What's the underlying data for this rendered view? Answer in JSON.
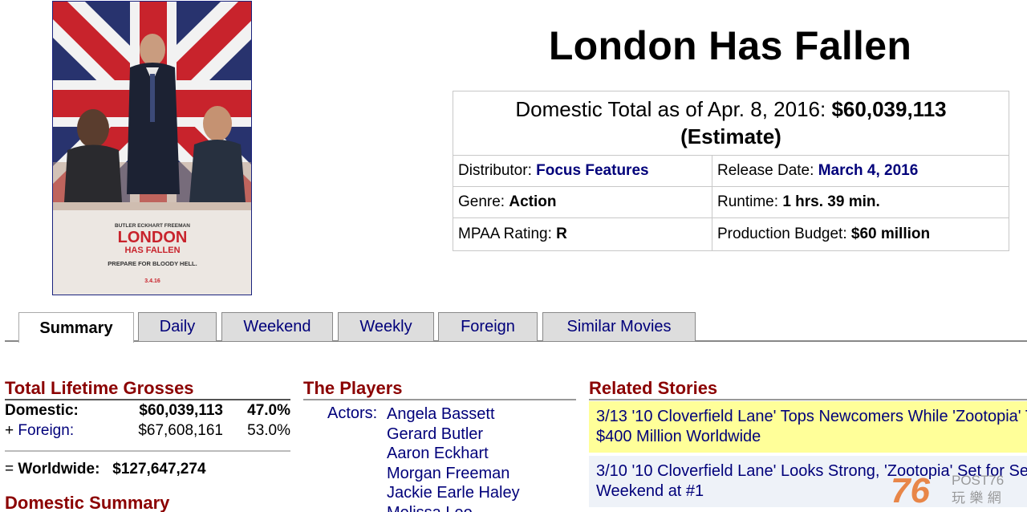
{
  "poster": {
    "cast_top": "BUTLER   ECKHART   FREEMAN",
    "title_line1": "LONDON",
    "title_line2": "HAS FALLEN",
    "tagline": "PREPARE FOR BLOODY HELL.",
    "date": "3.4.16"
  },
  "movie": {
    "title": "London Has Fallen"
  },
  "info": {
    "total_prefix": "Domestic Total as of Apr. 8, 2016:",
    "total_value": "$60,039,113",
    "total_note": "(Estimate)",
    "distributor_label": "Distributor:",
    "distributor_value": "Focus Features",
    "release_label": "Release Date:",
    "release_value": "March 4, 2016",
    "genre_label": "Genre:",
    "genre_value": "Action",
    "runtime_label": "Runtime:",
    "runtime_value": "1 hrs. 39 min.",
    "mpaa_label": "MPAA Rating:",
    "mpaa_value": "R",
    "budget_label": "Production Budget:",
    "budget_value": "$60 million"
  },
  "tabs": [
    {
      "label": "Summary",
      "active": true
    },
    {
      "label": "Daily"
    },
    {
      "label": "Weekend"
    },
    {
      "label": "Weekly"
    },
    {
      "label": "Foreign"
    },
    {
      "label": "Similar Movies"
    }
  ],
  "grosses": {
    "heading": "Total Lifetime Grosses",
    "domestic_label": "Domestic:",
    "domestic_amount": "$60,039,113",
    "domestic_pct": "47.0%",
    "foreign_prefix": "+",
    "foreign_label": "Foreign:",
    "foreign_amount": "$67,608,161",
    "foreign_pct": "53.0%",
    "worldwide_prefix": "=",
    "worldwide_label": "Worldwide:",
    "worldwide_amount": "$127,647,274"
  },
  "domestic_summary": {
    "heading": "Domestic Summary"
  },
  "players": {
    "heading": "The Players",
    "actors_label": "Actors:",
    "actors": [
      "Angela Bassett",
      "Gerard Butler",
      "Aaron Eckhart",
      "Morgan Freeman",
      "Jackie Earle Haley",
      "Melissa Leo"
    ]
  },
  "stories": {
    "heading": "Related Stories",
    "items": [
      {
        "line1": "3/13 '10 Cloverfield Lane' Tops Newcomers While 'Zootopia' Tops",
        "line2": "$400 Million Worldwide"
      },
      {
        "line1": "3/10 '10 Cloverfield Lane' Looks Strong, 'Zootopia' Set for Second",
        "line2": "Weekend at #1"
      }
    ]
  },
  "watermark": {
    "number": "76",
    "brand": "POST76",
    "cjk": "玩 樂 網"
  },
  "colors": {
    "link": "#00007a",
    "heading": "#8b0000",
    "highlight": "#ffff99"
  }
}
